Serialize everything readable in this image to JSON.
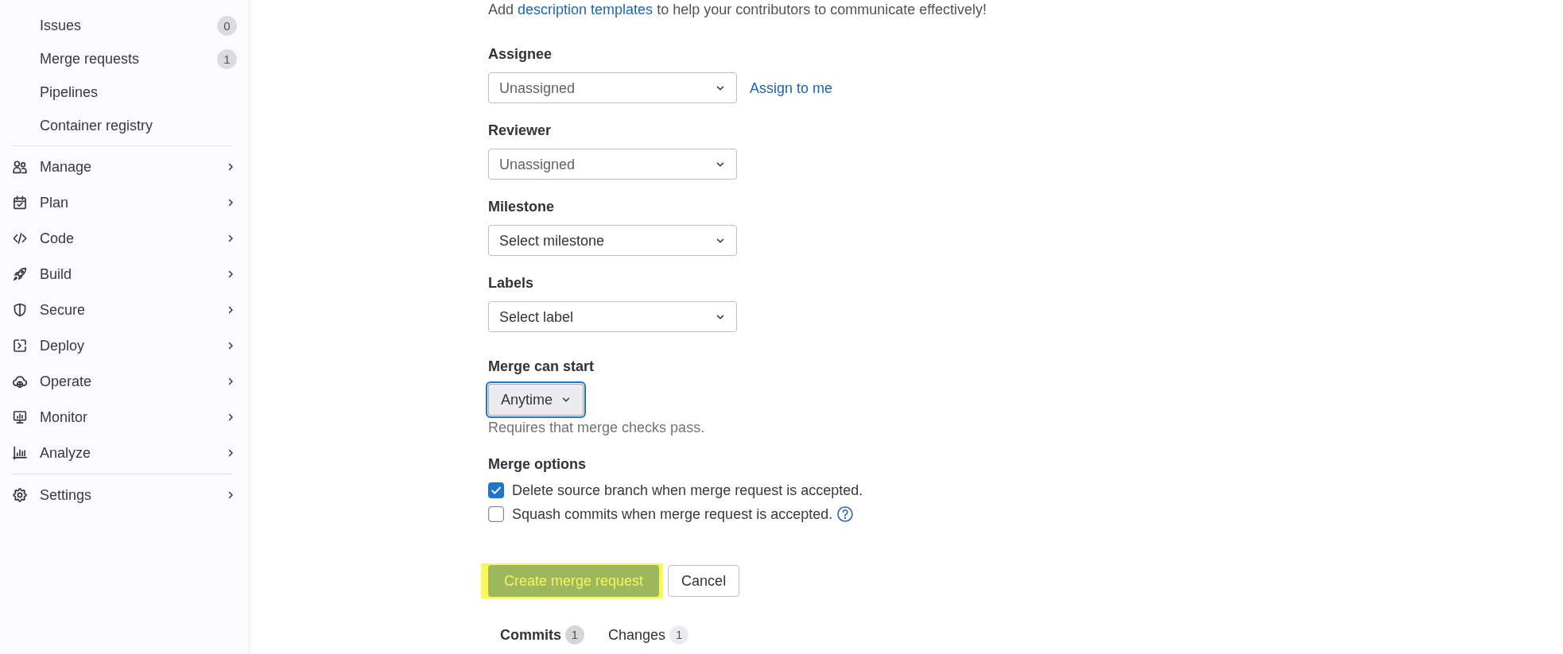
{
  "sidebar": {
    "sections": [
      {
        "items": [
          {
            "label": "Issues",
            "kind": "link",
            "count": "0"
          },
          {
            "label": "Merge requests",
            "kind": "link",
            "count": "1"
          },
          {
            "label": "Pipelines",
            "kind": "link"
          },
          {
            "label": "Container registry",
            "kind": "link"
          }
        ]
      },
      {
        "items": [
          {
            "label": "Manage",
            "kind": "menu",
            "expanded": false
          },
          {
            "label": "Plan",
            "kind": "menu",
            "expanded": false
          },
          {
            "label": "Code",
            "kind": "menu",
            "expanded": false
          },
          {
            "label": "Build",
            "kind": "menu",
            "expanded": false
          },
          {
            "label": "Secure",
            "kind": "menu",
            "expanded": false
          },
          {
            "label": "Deploy",
            "kind": "menu",
            "expanded": false
          },
          {
            "label": "Operate",
            "kind": "menu",
            "expanded": false
          },
          {
            "label": "Monitor",
            "kind": "menu",
            "expanded": false
          },
          {
            "label": "Analyze",
            "kind": "menu",
            "expanded": false
          }
        ]
      },
      {
        "items": [
          {
            "label": "Settings",
            "kind": "menu",
            "expanded": false
          }
        ]
      }
    ]
  },
  "intro": {
    "text_before": "Add ",
    "link": "description templates",
    "text_after": " to help your contributors to communicate effectively!"
  },
  "form": {
    "fields": [
      {
        "label": "Assignee",
        "kind": "select",
        "placeholder": "Unassigned",
        "action": "Assign to me"
      },
      {
        "label": "Reviewer",
        "kind": "select",
        "placeholder": "Unassigned"
      },
      {
        "label": "Milestone",
        "kind": "select",
        "value": "Select milestone"
      },
      {
        "label": "Labels",
        "kind": "select",
        "value": "Select label"
      },
      {
        "label": "Merge can start",
        "kind": "dropdown_button",
        "value": "Anytime",
        "focused": true,
        "help": "Requires that merge checks pass."
      },
      {
        "label": "Merge options",
        "kind": "checkboxes",
        "options": [
          {
            "label": "Delete source branch when merge request is accepted.",
            "checked": true
          },
          {
            "label": "Squash commits when merge request is accepted.",
            "checked": false,
            "help_icon": true
          }
        ]
      }
    ],
    "actions": [
      {
        "label": "Create merge request",
        "kind": "primary",
        "highlighted": true
      },
      {
        "label": "Cancel",
        "kind": "secondary"
      }
    ]
  },
  "tabs": [
    {
      "label": "Commits",
      "count": "1",
      "selected": true
    },
    {
      "label": "Changes",
      "count": "1",
      "selected": false
    }
  ]
}
